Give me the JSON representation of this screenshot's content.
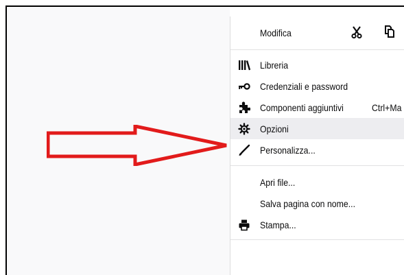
{
  "menu": {
    "edit": {
      "label": "Modifica",
      "cut_icon": "scissors-icon",
      "copy_icon": "copy-icon"
    },
    "items": [
      {
        "label": "Libreria",
        "icon": "library-icon"
      },
      {
        "label": "Credenziali e password",
        "icon": "key-icon"
      },
      {
        "label": "Componenti aggiuntivi",
        "icon": "puzzle-icon",
        "shortcut": "Ctrl+Ma"
      },
      {
        "label": "Opzioni",
        "icon": "gear-icon",
        "highlighted": true
      },
      {
        "label": "Personalizza...",
        "icon": "brush-icon"
      }
    ],
    "file_items": [
      {
        "label": "Apri file..."
      },
      {
        "label": "Salva pagina con nome..."
      },
      {
        "label": "Stampa...",
        "icon": "printer-icon"
      }
    ]
  },
  "annotation": {
    "arrow_color": "#e21b1b",
    "points_to": "Opzioni"
  },
  "colors": {
    "highlight": "#ededf0",
    "separator": "#e1e1e2",
    "text": "#0c0c0d"
  }
}
